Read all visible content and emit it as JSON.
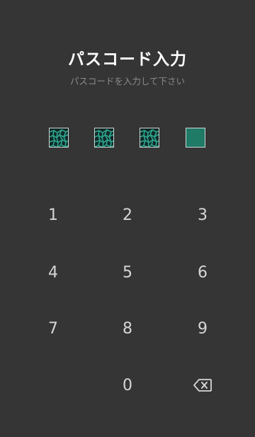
{
  "header": {
    "title": "パスコード入力",
    "subtitle": "パスコードを入力して下さい"
  },
  "passcode": {
    "entered_count": 3,
    "total_slots": 4,
    "filled_pattern": "teal-leopard",
    "empty_color": "#1f7a66"
  },
  "keypad": {
    "keys": [
      "1",
      "2",
      "3",
      "4",
      "5",
      "6",
      "7",
      "8",
      "9",
      "0"
    ],
    "backspace_icon": "backspace-icon"
  },
  "colors": {
    "background": "#353535",
    "title": "#ffffff",
    "subtitle": "#8a8a8a",
    "keys": "#d6d6d6",
    "accent": "#1f7a66"
  }
}
